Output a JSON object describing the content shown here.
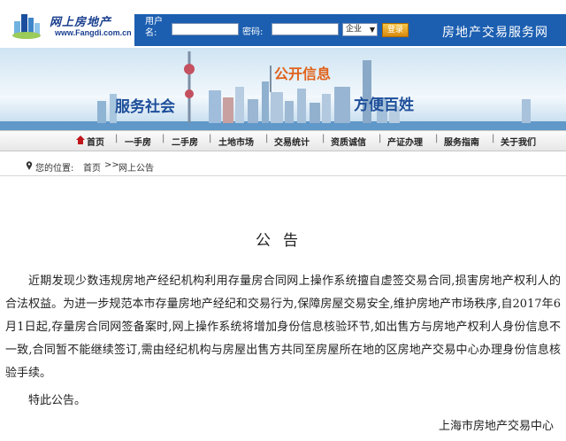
{
  "logo": {
    "cn": "网上房地产",
    "en": "www.Fangdi.com.cn"
  },
  "login": {
    "username_label": "用户名:",
    "password_label": "密码:",
    "account_type": "企业",
    "login_button": "登录"
  },
  "site_title": "房地产交易服务网",
  "banner": {
    "slogan_left": "服务社会",
    "slogan_center": "公开信息",
    "slogan_right": "方便百姓"
  },
  "nav": {
    "items": [
      "首页",
      "一手房",
      "二手房",
      "土地市场",
      "交易统计",
      "资质诚信",
      "产证办理",
      "服务指南",
      "关于我们"
    ]
  },
  "breadcrumb": {
    "prefix": "您的位置:",
    "home": "首页",
    "separator": ">>",
    "current": "网上公告"
  },
  "article": {
    "title": "公告",
    "body": "近期发现少数违规房地产经纪机构利用存量房合同网上操作系统擅自虚签交易合同,损害房地产权利人的合法权益。为进一步规范本市存量房地产经纪和交易行为,保障房屋交易安全,维护房地产市场秩序,自2017年6月1日起,存量房合同网签备案时,网上操作系统将增加身份信息核验环节,如出售方与房地产权利人身份信息不一致,合同暂不能继续签订,需由经纪机构与房屋出售方共同至房屋所在地的区房地产交易中心办理身份信息核验手续。",
    "closing": "特此公告。",
    "signature": "上海市房地产交易中心"
  },
  "colors": {
    "header_blue": "#1c5fb1",
    "nav_red": "#c0151b",
    "login_orange": "#e3a020"
  }
}
